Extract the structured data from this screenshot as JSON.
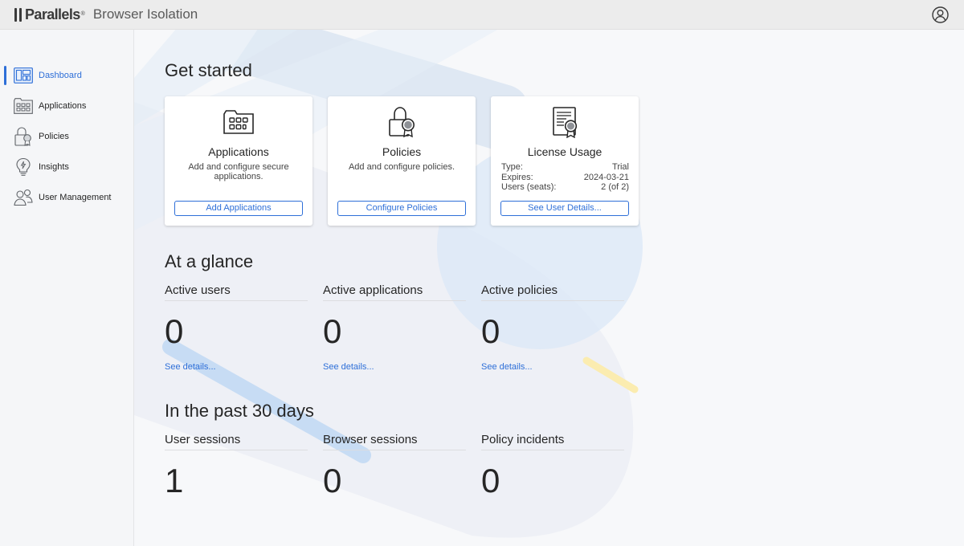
{
  "header": {
    "brand": "Parallels",
    "brand_mark": "®",
    "product": "Browser Isolation"
  },
  "sidebar": {
    "items": [
      {
        "label": "Dashboard",
        "icon": "dashboard-icon",
        "active": true
      },
      {
        "label": "Applications",
        "icon": "applications-icon",
        "active": false
      },
      {
        "label": "Policies",
        "icon": "policies-icon",
        "active": false
      },
      {
        "label": "Insights",
        "icon": "lightbulb-icon",
        "active": false
      },
      {
        "label": "User Management",
        "icon": "users-icon",
        "active": false
      }
    ]
  },
  "get_started": {
    "title": "Get started",
    "cards": [
      {
        "title": "Applications",
        "description": "Add and configure secure applications.",
        "button": "Add Applications"
      },
      {
        "title": "Policies",
        "description": "Add and configure policies.",
        "button": "Configure Policies"
      },
      {
        "title": "License Usage",
        "type_label": "Type:",
        "type_value": "Trial",
        "expires_label": "Expires:",
        "expires_value": "2024-03-21",
        "users_label": "Users (seats):",
        "users_value": "2 (of 2)",
        "button": "See User Details..."
      }
    ]
  },
  "at_a_glance": {
    "title": "At a glance",
    "stats": [
      {
        "label": "Active users",
        "value": "0",
        "link": "See details..."
      },
      {
        "label": "Active applications",
        "value": "0",
        "link": "See details..."
      },
      {
        "label": "Active policies",
        "value": "0",
        "link": "See details..."
      }
    ]
  },
  "past_30_days": {
    "title": "In the past 30 days",
    "stats": [
      {
        "label": "User sessions",
        "value": "1"
      },
      {
        "label": "Browser sessions",
        "value": "0"
      },
      {
        "label": "Policy incidents",
        "value": "0"
      }
    ]
  },
  "colors": {
    "accent": "#2e6fd8",
    "topbar": "#ececec",
    "deco_blue": "#dbe8f6",
    "deco_yellow": "#fbecb0"
  }
}
